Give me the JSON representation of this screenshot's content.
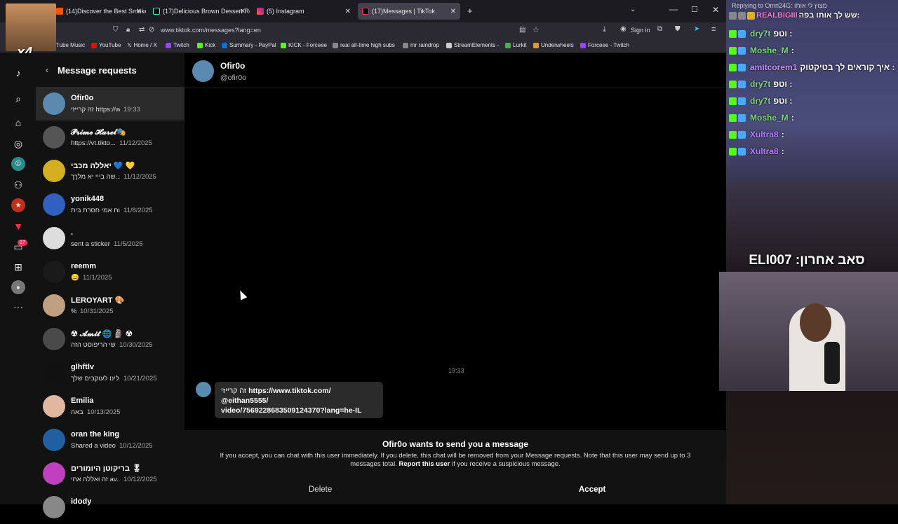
{
  "browser": {
    "tabs": [
      {
        "title": "(14)Discover the Best Smoke Tri",
        "active": false
      },
      {
        "title": "(17)Delicious Brown Dessert Re",
        "active": false
      },
      {
        "title": "(5) Instagram",
        "active": false
      },
      {
        "title": "(17)Messages | TikTok",
        "active": true
      }
    ],
    "url": "www.tiktok.com/messages?lang=en",
    "sign_in": "Sign in",
    "bookmarks": [
      "Tube Music",
      "YouTube",
      "Home / X",
      "Twitch",
      "Kick",
      "Summary - PayPal",
      "KICK - Forceee",
      "real all-time high subs",
      "mr raindrop",
      "StreamElements -",
      "Lurkit",
      "Underwheels",
      "Forceee - Twitch"
    ]
  },
  "overlay": {
    "multiplier": "x4"
  },
  "tiktok_nav": {
    "badge": "17"
  },
  "requests": {
    "title": "Message requests",
    "items": [
      {
        "name": "Ofir0o",
        "preview": "זה קרייזי https://ww...",
        "date": "19:33",
        "active": true,
        "color": "#5a8ab0"
      },
      {
        "name": "𝓟𝓻𝓲𝓶𝓮 𝓗𝓪𝓻𝓮𝓵🎭",
        "preview": "https://vt.tikto...",
        "date": "11/12/2025",
        "active": false,
        "color": "#555"
      },
      {
        "name": "יאללה מכבי 💙 💛",
        "preview": "שה בייי יא מלךך...",
        "date": "11/12/2025",
        "active": false,
        "color": "#d4b020"
      },
      {
        "name": "yonik448",
        "preview": "כוח אמי חסרת בית...",
        "date": "11/8/2025",
        "active": false,
        "color": "#3060c0"
      },
      {
        "name": ".",
        "preview": "sent a sticker",
        "date": "11/5/2025",
        "active": false,
        "color": "#ddd"
      },
      {
        "name": "reemm",
        "preview": "😐",
        "date": "11/1/2025",
        "active": false,
        "color": "#1a1a1a"
      },
      {
        "name": "LEROYART 🎨",
        "preview": "%",
        "date": "10/31/2025",
        "active": false,
        "color": "#c0a080"
      },
      {
        "name": "☢ 𝓐𝓶𝓲𝓽 🌐 🗿 ☢",
        "preview": "שי הריפוסט הזה",
        "date": "10/30/2025",
        "active": false,
        "color": "#4a4a4a"
      },
      {
        "name": "glhftlv",
        "preview": "לינו לעוקבים שלך...",
        "date": "10/21/2025",
        "active": false,
        "color": "#111"
      },
      {
        "name": "Emilia",
        "preview": "באה",
        "date": "10/13/2025",
        "active": false,
        "color": "#e0b8a0"
      },
      {
        "name": "oran the king",
        "preview": "Shared a video",
        "date": "10/12/2025",
        "active": false,
        "color": "#2060a0"
      },
      {
        "name": "בריקוטן היומורים 🎖",
        "preview": "זה ואללה אחי av...",
        "date": "10/12/2025",
        "active": false,
        "color": "#c040c0"
      },
      {
        "name": "idody",
        "preview": "",
        "date": "",
        "active": false,
        "color": "#888"
      }
    ]
  },
  "chat": {
    "name": "Ofir0o",
    "handle": "@ofir0o",
    "timestamp": "19:33",
    "message_line1_prefix": "זה קרייזי",
    "message_link1": "https://www.tiktok.com/",
    "message_link2": "@eithan5555/",
    "message_link3": "video/7569228683509124370?lang=he-IL",
    "request_title": "Ofir0o wants to send you a message",
    "request_body": "If you accept, you can chat with this user immediately. If you delete, this chat will be removed from your Message requests. Note that this user may send up to 3 messages total.",
    "report_link": "Report this user",
    "report_suffix": "if you receive a suspicious message.",
    "delete_label": "Delete",
    "accept_label": "Accept"
  },
  "twitch": {
    "top_notice": "Replying to Omri24G: מצוץ לי אותו",
    "top_line_user": "REALBIGIII",
    "top_line_text": "שש לך אותו בפה:",
    "lines": [
      {
        "user": "dry7t",
        "text": "וטפ :",
        "color": "#7fd67f"
      },
      {
        "user": "Moshe_M",
        "text": ":",
        "color": "#7fd67f"
      },
      {
        "user": "amitcorem1",
        "text": "איך קוראים לך בטיקטוק :",
        "color": "#c58cff"
      },
      {
        "user": "dry7t",
        "text": "וטפ :",
        "color": "#7fd67f"
      },
      {
        "user": "dry7t",
        "text": "וטפ :",
        "color": "#7fd67f"
      },
      {
        "user": "Moshe_M",
        "text": ":",
        "color": "#7fd67f"
      },
      {
        "user": "Xultra8",
        "text": ":",
        "color": "#b57cff"
      },
      {
        "user": "Xultra8",
        "text": ":",
        "color": "#b57cff"
      }
    ],
    "sub_label": "ELI007 :סאב אחרון"
  }
}
